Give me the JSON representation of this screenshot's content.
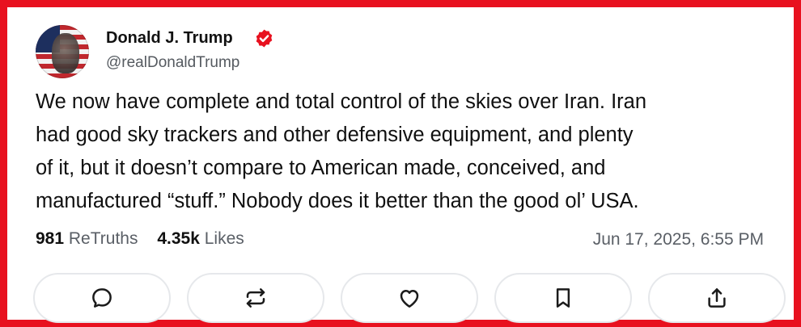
{
  "post": {
    "author_name": "Donald J. Trump",
    "author_handle": "@realDonaldTrump",
    "verified_badge_color": "#e8111f",
    "text": "We now have complete and total control of the skies over Iran. Iran\nhad good sky trackers and other defensive equipment, and plenty\nof it, but it doesn’t compare to American made, conceived, and\nmanufactured “stuff.”  Nobody does it better than the good ol’ USA.",
    "retruths_count": "981",
    "retruths_label": "ReTruths",
    "likes_count": "4.35k",
    "likes_label": "Likes",
    "timestamp": "Jun 17, 2025, 6:55 PM"
  },
  "frame": {
    "border_color": "#e8111f"
  },
  "actions": [
    {
      "icon": "reply-icon"
    },
    {
      "icon": "retruth-icon"
    },
    {
      "icon": "like-heart-icon"
    },
    {
      "icon": "bookmark-icon"
    },
    {
      "icon": "share-icon"
    }
  ]
}
